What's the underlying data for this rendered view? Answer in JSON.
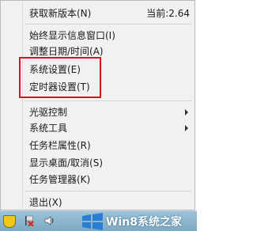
{
  "menu": {
    "items": [
      {
        "label": "获取新版本(N)",
        "right": "当前:2.64"
      },
      {
        "label": "始终显示信息窗口(I)"
      },
      {
        "label": "调整日期/时间(A)"
      },
      {
        "label": "系统设置(E)"
      },
      {
        "label": "定时器设置(T)"
      },
      {
        "label": "光驱控制",
        "submenu": true
      },
      {
        "label": "系统工具",
        "submenu": true
      },
      {
        "label": "任务栏属性(R)"
      },
      {
        "label": "显示桌面/取消(S)"
      },
      {
        "label": "任务管理器(K)"
      },
      {
        "label": "退出(X)"
      }
    ]
  },
  "taskbar": {
    "watermark": "Win8系统之家",
    "icons": [
      "shield-icon",
      "flag-icon",
      "volume-icon",
      "windows-logo-icon"
    ]
  }
}
